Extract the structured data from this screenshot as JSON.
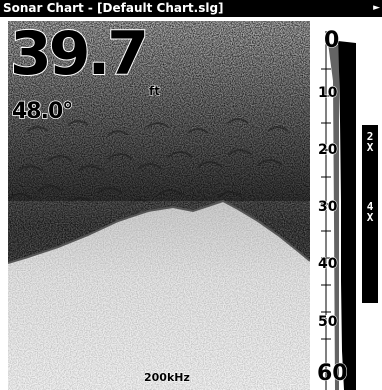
{
  "window": {
    "title": "Sonar Chart - [Default Chart.slg]",
    "menu_arrow": "►"
  },
  "readout": {
    "depth": "39.7",
    "depth_unit": "ft",
    "water_temp": "48.0°",
    "frequency": "200kHz"
  },
  "depth_scale": {
    "labels": [
      "0",
      "10",
      "20",
      "30",
      "40",
      "50",
      "60"
    ]
  },
  "zoom": {
    "options": [
      {
        "line1": "2",
        "line2": "X"
      },
      {
        "line1": "4",
        "line2": "X"
      }
    ]
  },
  "colors": {
    "title_bar": "#000000",
    "water_noise": "#333333",
    "bottom_return": "#e6e6e6"
  }
}
